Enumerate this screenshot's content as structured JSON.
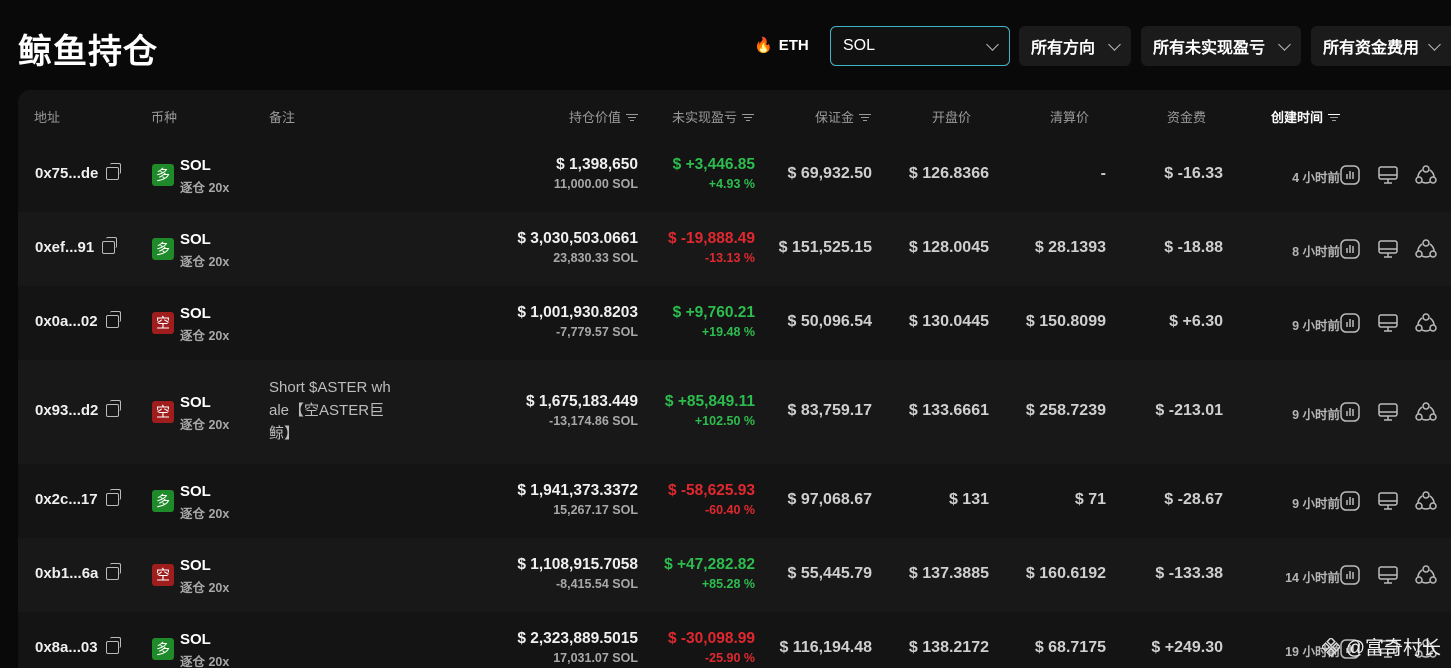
{
  "page": {
    "title": "鲸鱼持仓"
  },
  "filters": {
    "eth_chip": "ETH",
    "coin_select": "SOL",
    "direction_select": "所有方向",
    "pnl_select": "所有未实现盈亏",
    "funding_select": "所有资金费用"
  },
  "table": {
    "headers": {
      "address": "地址",
      "coin": "币种",
      "note": "备注",
      "position_value": "持仓价值",
      "unrealized_pnl": "未实现盈亏",
      "margin": "保证金",
      "entry_price": "开盘价",
      "liq_price": "清算价",
      "funding": "资金费",
      "created": "创建时间"
    },
    "rows": [
      {
        "address": "0x75...de",
        "side": "多",
        "side_type": "long",
        "coin": "SOL",
        "leverage": "逐仓 20x",
        "note": "",
        "value": "$ 1,398,650",
        "size": "11,000.00 SOL",
        "pnl": "$ +3,446.85",
        "pnl_pct": "+4.93 %",
        "pnl_dir": "green",
        "margin": "$ 69,932.50",
        "entry": "$ 126.8366",
        "liq": "-",
        "funding": "$ -16.33",
        "funding_dir": "red",
        "created": "4 小时前"
      },
      {
        "address": "0xef...91",
        "side": "多",
        "side_type": "long",
        "coin": "SOL",
        "leverage": "逐仓 20x",
        "note": "",
        "value": "$ 3,030,503.0661",
        "size": "23,830.33 SOL",
        "pnl": "$ -19,888.49",
        "pnl_pct": "-13.13 %",
        "pnl_dir": "red",
        "margin": "$ 151,525.15",
        "entry": "$ 128.0045",
        "liq": "$ 28.1393",
        "funding": "$ -18.88",
        "funding_dir": "red",
        "created": "8 小时前"
      },
      {
        "address": "0x0a...02",
        "side": "空",
        "side_type": "short",
        "coin": "SOL",
        "leverage": "逐仓 20x",
        "note": "",
        "value": "$ 1,001,930.8203",
        "size": "-7,779.57 SOL",
        "pnl": "$ +9,760.21",
        "pnl_pct": "+19.48 %",
        "pnl_dir": "green",
        "margin": "$ 50,096.54",
        "entry": "$ 130.0445",
        "liq": "$ 150.8099",
        "funding": "$ +6.30",
        "funding_dir": "green",
        "created": "9 小时前"
      },
      {
        "address": "0x93...d2",
        "side": "空",
        "side_type": "short",
        "coin": "SOL",
        "leverage": "逐仓 20x",
        "note": "Short $ASTER whale【空ASTER巨鲸】",
        "value": "$ 1,675,183.449",
        "size": "-13,174.86 SOL",
        "pnl": "$ +85,849.11",
        "pnl_pct": "+102.50 %",
        "pnl_dir": "green",
        "margin": "$ 83,759.17",
        "entry": "$ 133.6661",
        "liq": "$ 258.7239",
        "funding": "$ -213.01",
        "funding_dir": "red",
        "created": "9 小时前"
      },
      {
        "address": "0x2c...17",
        "side": "多",
        "side_type": "long",
        "coin": "SOL",
        "leverage": "逐仓 20x",
        "note": "",
        "value": "$ 1,941,373.3372",
        "size": "15,267.17 SOL",
        "pnl": "$ -58,625.93",
        "pnl_pct": "-60.40 %",
        "pnl_dir": "red",
        "margin": "$ 97,068.67",
        "entry": "$ 131",
        "liq": "$ 71",
        "funding": "$ -28.67",
        "funding_dir": "red",
        "created": "9 小时前"
      },
      {
        "address": "0xb1...6a",
        "side": "空",
        "side_type": "short",
        "coin": "SOL",
        "leverage": "逐仓 20x",
        "note": "",
        "value": "$ 1,108,915.7058",
        "size": "-8,415.54 SOL",
        "pnl": "$ +47,282.82",
        "pnl_pct": "+85.28 %",
        "pnl_dir": "green",
        "margin": "$ 55,445.79",
        "entry": "$ 137.3885",
        "liq": "$ 160.6192",
        "funding": "$ -133.38",
        "funding_dir": "red",
        "created": "14 小时前"
      },
      {
        "address": "0x8a...03",
        "side": "多",
        "side_type": "long",
        "coin": "SOL",
        "leverage": "逐仓 20x",
        "note": "",
        "value": "$ 2,323,889.5015",
        "size": "17,031.07 SOL",
        "pnl": "$ -30,098.99",
        "pnl_pct": "-25.90 %",
        "pnl_dir": "red",
        "margin": "$ 116,194.48",
        "entry": "$ 138.2172",
        "liq": "$ 68.7175",
        "funding": "$ +249.30",
        "funding_dir": "green",
        "created": "19 小时前"
      }
    ]
  },
  "watermark": "@富奇村长",
  "icons": [
    "fire-icon",
    "chevron-down-icon",
    "copy-icon",
    "chart-bars-icon",
    "monitor-icon",
    "share-icon",
    "sort-icon"
  ],
  "colors": {
    "accent": "#3fb6c8",
    "long": "#1f8a2a",
    "short": "#a01d1d",
    "positive": "#2dbd4e",
    "negative": "#e0282e"
  }
}
